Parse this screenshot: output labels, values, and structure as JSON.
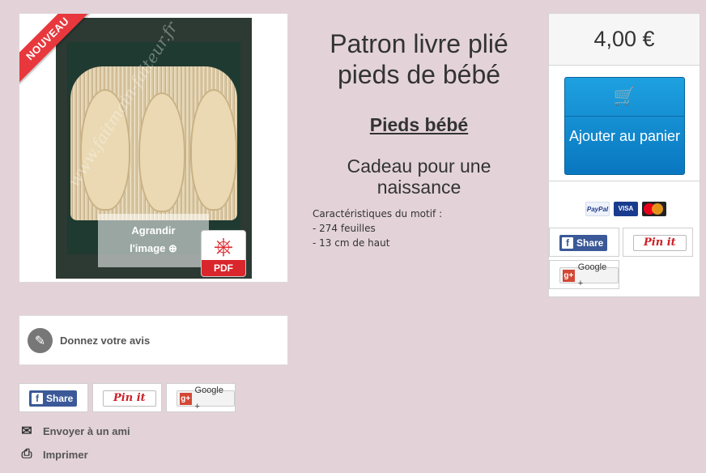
{
  "product": {
    "title": "Patron livre plié pieds de bébé",
    "subtitle": "Pieds bébé",
    "tagline": "Cadeau pour une naissance",
    "details_heading": "Caractéristiques du motif :",
    "details": [
      "- 274 feuilles",
      "- 13 cm de haut"
    ]
  },
  "image": {
    "badge": "NOUVEAU",
    "watermark": "www.faitmain-faiteur.fr",
    "zoom_line1": "Agrandir",
    "zoom_line2": "l'image",
    "pdf_label": "PDF"
  },
  "buy": {
    "price": "4,00 €",
    "cart_label": "Ajouter au panier",
    "payments": [
      "PayPal",
      "VISA",
      "MasterCard"
    ]
  },
  "share": {
    "facebook": "Share",
    "pinterest": "Pin it",
    "google": "Google +"
  },
  "review": {
    "label": "Donnez votre avis"
  },
  "actions": {
    "send_friend": "Envoyer à un ami",
    "print": "Imprimer"
  },
  "colors": {
    "background": "#e3d3d8",
    "cart_blue": "#0e86cf",
    "badge_red": "#e8383d"
  }
}
